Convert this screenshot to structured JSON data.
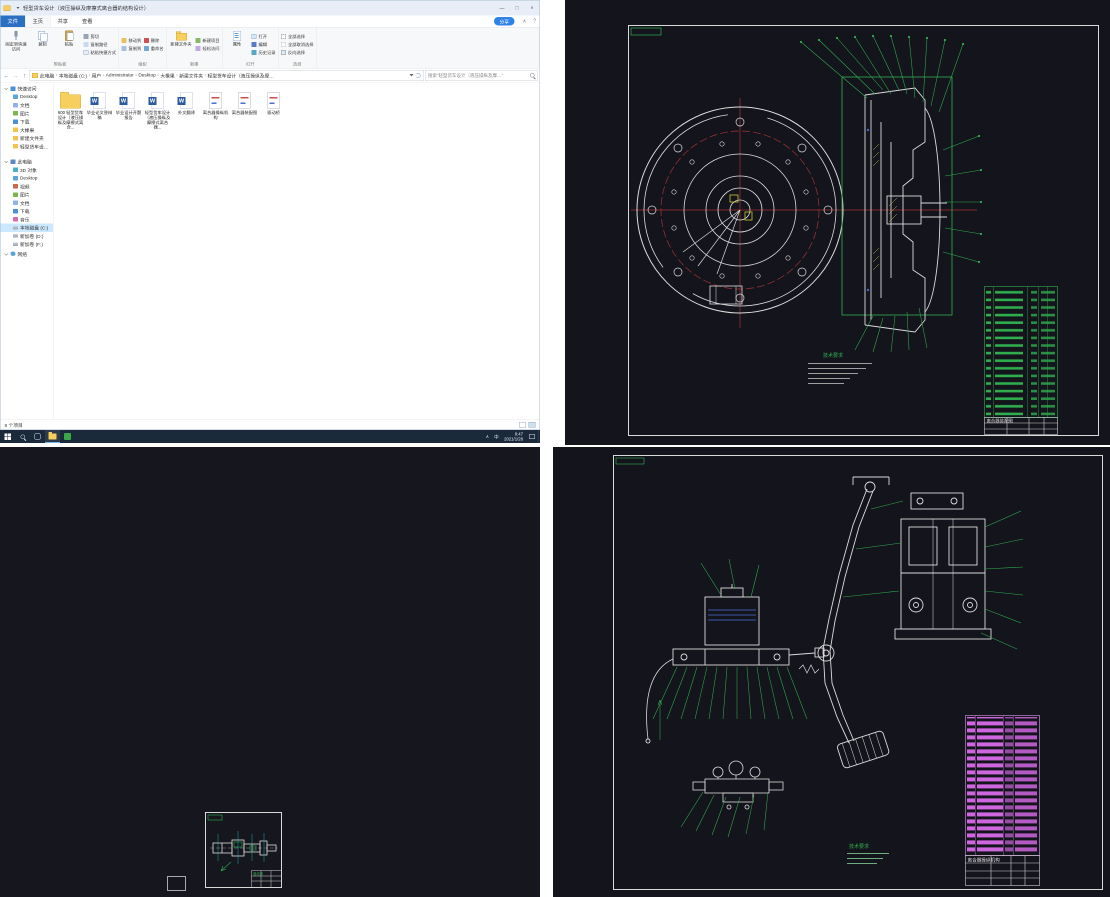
{
  "window": {
    "title": "轻型货车设计（液压操纵及摩擦式离合器的结构设计）",
    "min": "—",
    "max": "□",
    "close": "×"
  },
  "tabs": {
    "file": "文件",
    "home": "主页",
    "share": "共享",
    "view": "查看",
    "badge": "分享",
    "collapse": "∧",
    "help": "?"
  },
  "ribbon": {
    "pin": "固定到快速访问",
    "copy": "复制",
    "paste": "粘贴",
    "cut": "剪切",
    "copy_path": "复制路径",
    "paste_shortcut": "粘贴快捷方式",
    "move_to": "移动到",
    "copy_to": "复制到",
    "delete": "删除",
    "rename": "重命名",
    "new_folder": "新建文件夹",
    "new_item": "新建项目",
    "easy_access": "轻松访问",
    "properties": "属性",
    "open": "打开",
    "edit": "编辑",
    "history": "历史记录",
    "select_all": "全部选择",
    "select_none": "全部取消选择",
    "invert": "反向选择",
    "g_clipboard": "剪贴板",
    "g_organize": "组织",
    "g_new": "新建",
    "g_open": "打开",
    "g_select": "选择"
  },
  "address": {
    "back": "←",
    "forward": "→",
    "up": "↑",
    "separator": "›",
    "segments": [
      {
        "label": "此电脑"
      },
      {
        "label": "本地磁盘 (C:)"
      },
      {
        "label": "用户"
      },
      {
        "label": "Administrator"
      },
      {
        "label": "Desktop"
      },
      {
        "label": "大橡果"
      },
      {
        "label": "新建文件夹"
      },
      {
        "label": "轻型货车设计（液压操纵及摩…"
      }
    ],
    "search": "搜索“轻型货车设计（液压操纵及摩…”"
  },
  "nav": {
    "items": [
      {
        "label": "快速访问",
        "type": "star",
        "level": 0
      },
      {
        "label": "Desktop",
        "type": "desktop",
        "level": 1
      },
      {
        "label": "文档",
        "type": "doc",
        "level": 1
      },
      {
        "label": "图片",
        "type": "pic",
        "level": 1
      },
      {
        "label": "下载",
        "type": "down",
        "level": 1
      },
      {
        "label": "大橡果",
        "type": "folder",
        "level": 1
      },
      {
        "label": "新建文件夹",
        "type": "folder",
        "level": 1
      },
      {
        "label": "轻型货车设计（液压…",
        "type": "folder",
        "level": 1
      },
      {
        "label": "此电脑",
        "type": "pc",
        "level": 0
      },
      {
        "label": "3D 对象",
        "type": "d3",
        "level": 1
      },
      {
        "label": "Desktop",
        "type": "desktop",
        "level": 1
      },
      {
        "label": "视频",
        "type": "video",
        "level": 1
      },
      {
        "label": "图片",
        "type": "pic",
        "level": 1
      },
      {
        "label": "文档",
        "type": "doc",
        "level": 1
      },
      {
        "label": "下载",
        "type": "down",
        "level": 1
      },
      {
        "label": "音乐",
        "type": "music",
        "level": 1
      },
      {
        "label": "本地磁盘 (C:)",
        "type": "disk",
        "level": 1,
        "selected": true
      },
      {
        "label": "新加卷 (D:)",
        "type": "disk",
        "level": 1
      },
      {
        "label": "新加卷 (F:)",
        "type": "disk",
        "level": 1
      },
      {
        "label": "网络",
        "type": "net",
        "level": 0
      }
    ]
  },
  "files": {
    "items": [
      {
        "name": "600 轻型货车设计（液压操纵及摩擦式离合...",
        "type": "folder"
      },
      {
        "name": "毕业论文答辩稿",
        "type": "word"
      },
      {
        "name": "毕业设计开题报告",
        "type": "word"
      },
      {
        "name": "轻型货车设计（液压操纵及摩擦式离合器...",
        "type": "word"
      },
      {
        "name": "外文翻译",
        "type": "word"
      },
      {
        "name": "离合器操纵机构",
        "type": "dwg"
      },
      {
        "name": "离合器装配图",
        "type": "dwg"
      },
      {
        "name": "驱动桥",
        "type": "dwg"
      }
    ],
    "status": "8 个项目"
  },
  "taskbar": {
    "tray_expand": "∧",
    "ime": "中",
    "time": "8:47",
    "date": "2021/1/28"
  },
  "cad": {
    "assembly": {
      "title_block": "离合器装配图",
      "tech": "技术要求"
    },
    "axle": {
      "title_block": "驱动桥"
    },
    "pedal": {
      "title_block": "离合器操纵机构",
      "tech": "技术要求"
    }
  }
}
